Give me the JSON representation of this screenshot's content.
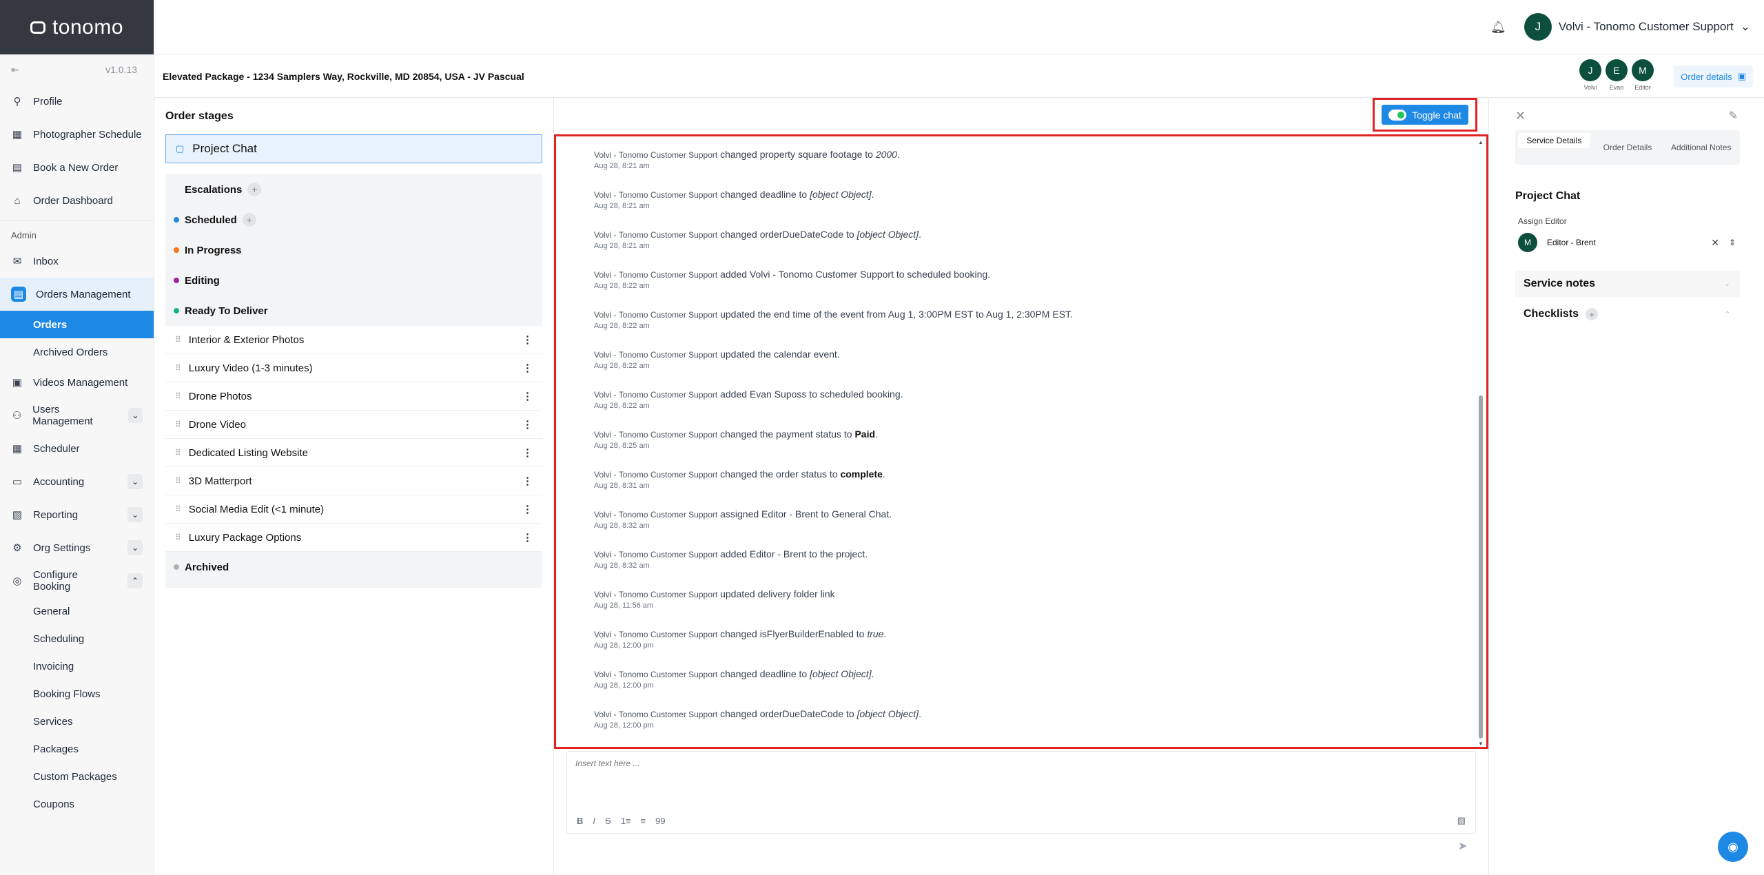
{
  "brand": {
    "name": "tonomo",
    "version": "v1.0.13"
  },
  "sidebar": {
    "items_top": [
      {
        "label": "Profile",
        "icon": "user-icon"
      },
      {
        "label": "Photographer Schedule",
        "icon": "calendar-icon"
      },
      {
        "label": "Book a New Order",
        "icon": "book-icon"
      },
      {
        "label": "Order Dashboard",
        "icon": "home-icon"
      }
    ],
    "section_admin": "Admin",
    "inbox": "Inbox",
    "orders_management": "Orders Management",
    "orders": "Orders",
    "archived_orders": "Archived Orders",
    "videos_management": "Videos Management",
    "users_management": "Users Management",
    "scheduler": "Scheduler",
    "accounting": "Accounting",
    "reporting": "Reporting",
    "org_settings": "Org Settings",
    "configure_booking": "Configure Booking",
    "configure_sub": [
      "General",
      "Scheduling",
      "Invoicing",
      "Booking Flows",
      "Services",
      "Packages",
      "Custom Packages",
      "Coupons"
    ]
  },
  "header": {
    "user_initial": "J",
    "user_name": "Volvi - Tonomo Customer Support"
  },
  "order": {
    "title": "Elevated Package - 1234 Samplers Way, Rockville, MD 20854, USA - JV Pascual",
    "participants": [
      {
        "initial": "J",
        "name": "Volvi"
      },
      {
        "initial": "E",
        "name": "Evan"
      },
      {
        "initial": "M",
        "name": "Editor"
      }
    ],
    "details_button": "Order details"
  },
  "stages": {
    "title": "Order stages",
    "project_chat": "Project Chat",
    "groups": [
      {
        "label": "Escalations",
        "color": "",
        "plus": true
      },
      {
        "label": "Scheduled",
        "color": "#1e88e5",
        "plus": true
      },
      {
        "label": "In Progress",
        "color": "#f97316",
        "plus": false
      },
      {
        "label": "Editing",
        "color": "#a020a0",
        "plus": false
      },
      {
        "label": "Ready To Deliver",
        "color": "#10b981",
        "plus": false
      }
    ],
    "services": [
      "Interior & Exterior Photos",
      "Luxury Video (1-3 minutes)",
      "Drone Photos",
      "Drone Video",
      "Dedicated Listing Website",
      "3D Matterport",
      "Social Media Edit (<1 minute)",
      "Luxury Package Options"
    ],
    "archived": "Archived",
    "archived_color": "#b0b0b0"
  },
  "chat": {
    "toggle_label": "Toggle chat",
    "actor": "Volvi - Tonomo Customer Support",
    "entries": [
      {
        "action": "changed property square footage to",
        "value": "2000",
        "style": "i",
        "suffix": ".",
        "time": "Aug 28, 8:21 am"
      },
      {
        "action": "changed deadline to",
        "value": "[object Object]",
        "style": "i",
        "suffix": ".",
        "time": "Aug 28, 8:21 am"
      },
      {
        "action": "changed orderDueDateCode to",
        "value": "[object Object]",
        "style": "i",
        "suffix": ".",
        "time": "Aug 28, 8:21 am"
      },
      {
        "action": "added Volvi - Tonomo Customer Support to scheduled booking.",
        "value": "",
        "style": "",
        "suffix": "",
        "time": "Aug 28, 8:22 am"
      },
      {
        "action": "updated the end time of the event from Aug 1, 3:00PM EST to Aug 1, 2:30PM EST.",
        "value": "",
        "style": "",
        "suffix": "",
        "time": "Aug 28, 8:22 am"
      },
      {
        "action": "updated the calendar event.",
        "value": "",
        "style": "",
        "suffix": "",
        "time": "Aug 28, 8:22 am"
      },
      {
        "action": "added Evan Suposs to scheduled booking.",
        "value": "",
        "style": "",
        "suffix": "",
        "time": "Aug 28, 8:22 am"
      },
      {
        "action": "changed the payment status to",
        "value": "Paid",
        "style": "b",
        "suffix": ".",
        "time": "Aug 28, 8:25 am"
      },
      {
        "action": "changed the order status to",
        "value": "complete",
        "style": "b",
        "suffix": ".",
        "time": "Aug 28, 8:31 am"
      },
      {
        "action": "assigned Editor - Brent to General Chat.",
        "value": "",
        "style": "",
        "suffix": "",
        "time": "Aug 28, 8:32 am"
      },
      {
        "action": "added Editor - Brent to the project.",
        "value": "",
        "style": "",
        "suffix": "",
        "time": "Aug 28, 8:32 am"
      },
      {
        "action": "updated delivery folder link",
        "value": "",
        "style": "",
        "suffix": "",
        "time": "Aug 28, 11:56 am"
      },
      {
        "action": "changed isFlyerBuilderEnabled to",
        "value": "true",
        "style": "i",
        "suffix": ".",
        "time": "Aug 28, 12:00 pm"
      },
      {
        "action": "changed deadline to",
        "value": "[object Object]",
        "style": "i",
        "suffix": ".",
        "time": "Aug 28, 12:00 pm"
      },
      {
        "action": "changed orderDueDateCode to",
        "value": "[object Object]",
        "style": "i",
        "suffix": ".",
        "time": "Aug 28, 12:00 pm"
      }
    ],
    "input_placeholder": "Insert text here ...",
    "tools": [
      "B",
      "I",
      "S",
      "1≡",
      "≡",
      "99"
    ]
  },
  "right_panel": {
    "tabs": [
      "Service Details",
      "Order Details",
      "Additional Notes"
    ],
    "active_tab": 0,
    "heading": "Project Chat",
    "assign_label": "Assign Editor",
    "editor_initial": "M",
    "editor_name": "Editor - Brent",
    "service_notes": "Service notes",
    "checklists": "Checklists"
  },
  "colors": {
    "accent": "#1e88e5",
    "highlight_border": "#e02424",
    "avatar": "#0b4f3c"
  }
}
